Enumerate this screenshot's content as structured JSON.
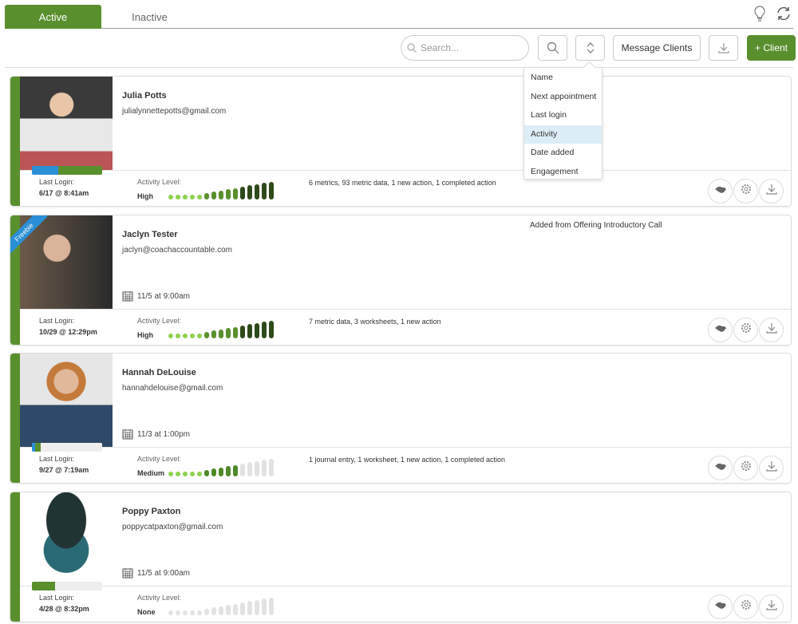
{
  "tabs": [
    {
      "label": "Active",
      "active": true
    },
    {
      "label": "Inactive",
      "active": false
    }
  ],
  "header_icons": [
    "lightbulb-icon",
    "refresh-icon"
  ],
  "toolbar": {
    "search_placeholder": "Search...",
    "message_clients": "Message Clients",
    "add_client": "+ Client"
  },
  "sort_menu": {
    "items": [
      "Name",
      "Next appointment",
      "Last login",
      "Activity",
      "Date added",
      "Engagement"
    ],
    "selected": "Activity"
  },
  "colors": {
    "brand_green": "#5a8f2e",
    "engagement_blue": "#2b8fd6",
    "menu_highlight": "#ddedf8"
  },
  "labels": {
    "last_login": "Last Login:",
    "activity_level": "Activity Level:"
  },
  "clients": [
    {
      "name": "Julia Potts",
      "email": "julialynnettepotts@gmail.com",
      "appointment": "",
      "note": "",
      "badge": "",
      "last_login": "6/17 @ 8:41am",
      "activity_level": "High",
      "activity_filled": 15,
      "engagement": {
        "blue": 0.37,
        "green": 0.63
      },
      "summary": "6 metrics, 93 metric data, 1 new action, 1 completed action"
    },
    {
      "name": "Jaclyn Tester",
      "email": "jaclyn@coachaccountable.com",
      "appointment": "11/5 at 9:00am",
      "note": "Added from Offering Introductory Call",
      "badge": "Freebie",
      "last_login": "10/29 @ 12:29pm",
      "activity_level": "High",
      "activity_filled": 15,
      "engagement": null,
      "summary": "7 metric data, 3 worksheets, 1 new action"
    },
    {
      "name": "Hannah DeLouise",
      "email": "hannahdelouise@gmail.com",
      "appointment": "11/3 at 1:00pm",
      "note": "",
      "badge": "",
      "last_login": "9/27 @ 7:19am",
      "activity_level": "Medium",
      "activity_filled": 10,
      "engagement": {
        "blue": 0.04,
        "green": 0.08
      },
      "summary": "1 journal entry, 1 worksheet, 1 new action, 1 completed action"
    },
    {
      "name": "Poppy Paxton",
      "email": "poppycatpaxton@gmail.com",
      "appointment": "11/5 at 9:00am",
      "note": "",
      "badge": "",
      "last_login": "4/28 @ 8:32pm",
      "activity_level": "None",
      "activity_filled": 0,
      "engagement": {
        "blue": 0,
        "green": 0.33
      },
      "summary": ""
    }
  ]
}
